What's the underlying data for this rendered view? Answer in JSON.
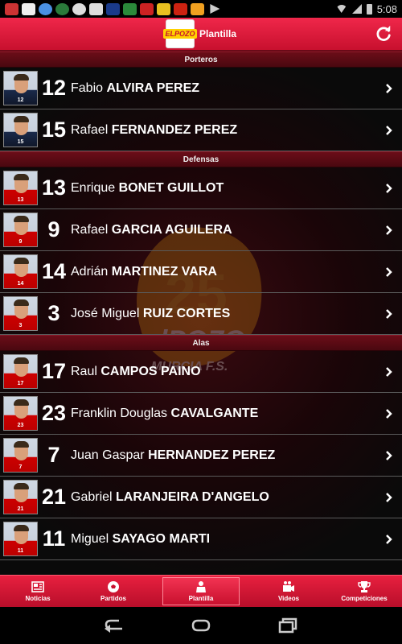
{
  "status_bar": {
    "time": "5:08"
  },
  "header": {
    "title": "Plantilla",
    "logo_text": "ELPOZO"
  },
  "watermark": {
    "years": "25",
    "text": "elPOZO",
    "subtext": "MURCIA F.S."
  },
  "sections": [
    {
      "title": "Porteros",
      "players": [
        {
          "number": "12",
          "first": "Fabio",
          "last": "ALVIRA PEREZ",
          "kit": "gk"
        },
        {
          "number": "15",
          "first": "Rafael",
          "last": "FERNANDEZ PEREZ",
          "kit": "gk"
        }
      ]
    },
    {
      "title": "Defensas",
      "players": [
        {
          "number": "13",
          "first": "Enrique",
          "last": "BONET GUILLOT",
          "kit": "field"
        },
        {
          "number": "9",
          "first": "Rafael",
          "last": "GARCIA AGUILERA",
          "kit": "field"
        },
        {
          "number": "14",
          "first": "Adrián",
          "last": "MARTINEZ VARA",
          "kit": "field"
        },
        {
          "number": "3",
          "first": "José Miguel",
          "last": "RUIZ CORTES",
          "kit": "field"
        }
      ]
    },
    {
      "title": "Alas",
      "players": [
        {
          "number": "17",
          "first": "Raul",
          "last": "CAMPOS PAINO",
          "kit": "field"
        },
        {
          "number": "23",
          "first": "Franklin Douglas",
          "last": "CAVALGANTE",
          "kit": "field"
        },
        {
          "number": "7",
          "first": "Juan Gaspar",
          "last": "HERNANDEZ PEREZ",
          "kit": "field"
        },
        {
          "number": "21",
          "first": "Gabriel",
          "last": "LARANJEIRA D'ANGELO",
          "kit": "field"
        },
        {
          "number": "11",
          "first": "Miguel",
          "last": "SAYAGO MARTI",
          "kit": "field"
        }
      ]
    }
  ],
  "tabs": [
    {
      "label": "Noticias",
      "icon": "newspaper-icon",
      "active": false
    },
    {
      "label": "Partidos",
      "icon": "soccer-ball-icon",
      "active": false
    },
    {
      "label": "Plantilla",
      "icon": "players-icon",
      "active": true
    },
    {
      "label": "Videos",
      "icon": "video-camera-icon",
      "active": false
    },
    {
      "label": "Competiciones",
      "icon": "trophy-icon",
      "active": false
    }
  ],
  "colors": {
    "brand_red": "#c8102e",
    "section_bg": "#5a0b14"
  }
}
